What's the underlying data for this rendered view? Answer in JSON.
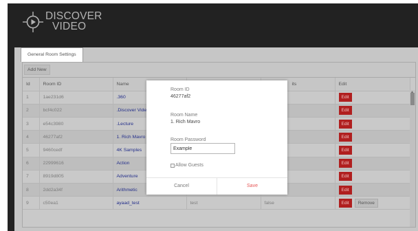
{
  "brand": {
    "line1": "DISCOVER",
    "line2": "VIDEO"
  },
  "tabs": [
    {
      "label": "General Room Settings"
    }
  ],
  "toolbar": {
    "add_label": "Add New"
  },
  "table": {
    "columns": [
      "Id",
      "Room ID",
      "Name",
      "",
      "Guests",
      "Edit"
    ],
    "rows": [
      {
        "id": "1",
        "room_id": "1ae231d6",
        "name": ".360",
        "password": "",
        "guests": "",
        "edit": "Edit"
      },
      {
        "id": "2",
        "room_id": "bcf4c022",
        "name": ".Discover Video",
        "password": "",
        "guests": "",
        "edit": "Edit"
      },
      {
        "id": "3",
        "room_id": "e54c3980",
        "name": ".Lecture",
        "password": "",
        "guests": "",
        "edit": "Edit"
      },
      {
        "id": "4",
        "room_id": "46277af2",
        "name": "1. Rich Mavro",
        "password": "",
        "guests": "",
        "edit": "Edit"
      },
      {
        "id": "5",
        "room_id": "9460cedf",
        "name": "4K Samples",
        "password": "",
        "guests": "",
        "edit": "Edit"
      },
      {
        "id": "6",
        "room_id": "22999616",
        "name": "Action",
        "password": "",
        "guests": "",
        "edit": "Edit"
      },
      {
        "id": "7",
        "room_id": "8919d805",
        "name": "Adventure",
        "password": "",
        "guests": "",
        "edit": "Edit"
      },
      {
        "id": "8",
        "room_id": "2dd2a34f",
        "name": "Arithmetic",
        "password": "",
        "guests": "",
        "edit": "Edit"
      },
      {
        "id": "9",
        "room_id": "c50ea1",
        "name": "ayaad_test",
        "password": "test",
        "guests": "false",
        "edit": "Edit",
        "remove": "Remove"
      }
    ]
  },
  "modal": {
    "room_id_label": "Room ID",
    "room_id_value": "46277af2",
    "room_name_label": "Room Name",
    "room_name_value": "1. Rich Mavro",
    "password_label": "Room Password",
    "password_value": "Example",
    "allow_guests_label": "Allow Guests",
    "cancel_label": "Cancel",
    "save_label": "Save"
  },
  "colors": {
    "frame": "#222222",
    "panel": "#c6c6c6",
    "edit": "#b01f1f",
    "save": "#e65656",
    "link": "#232e8a"
  }
}
